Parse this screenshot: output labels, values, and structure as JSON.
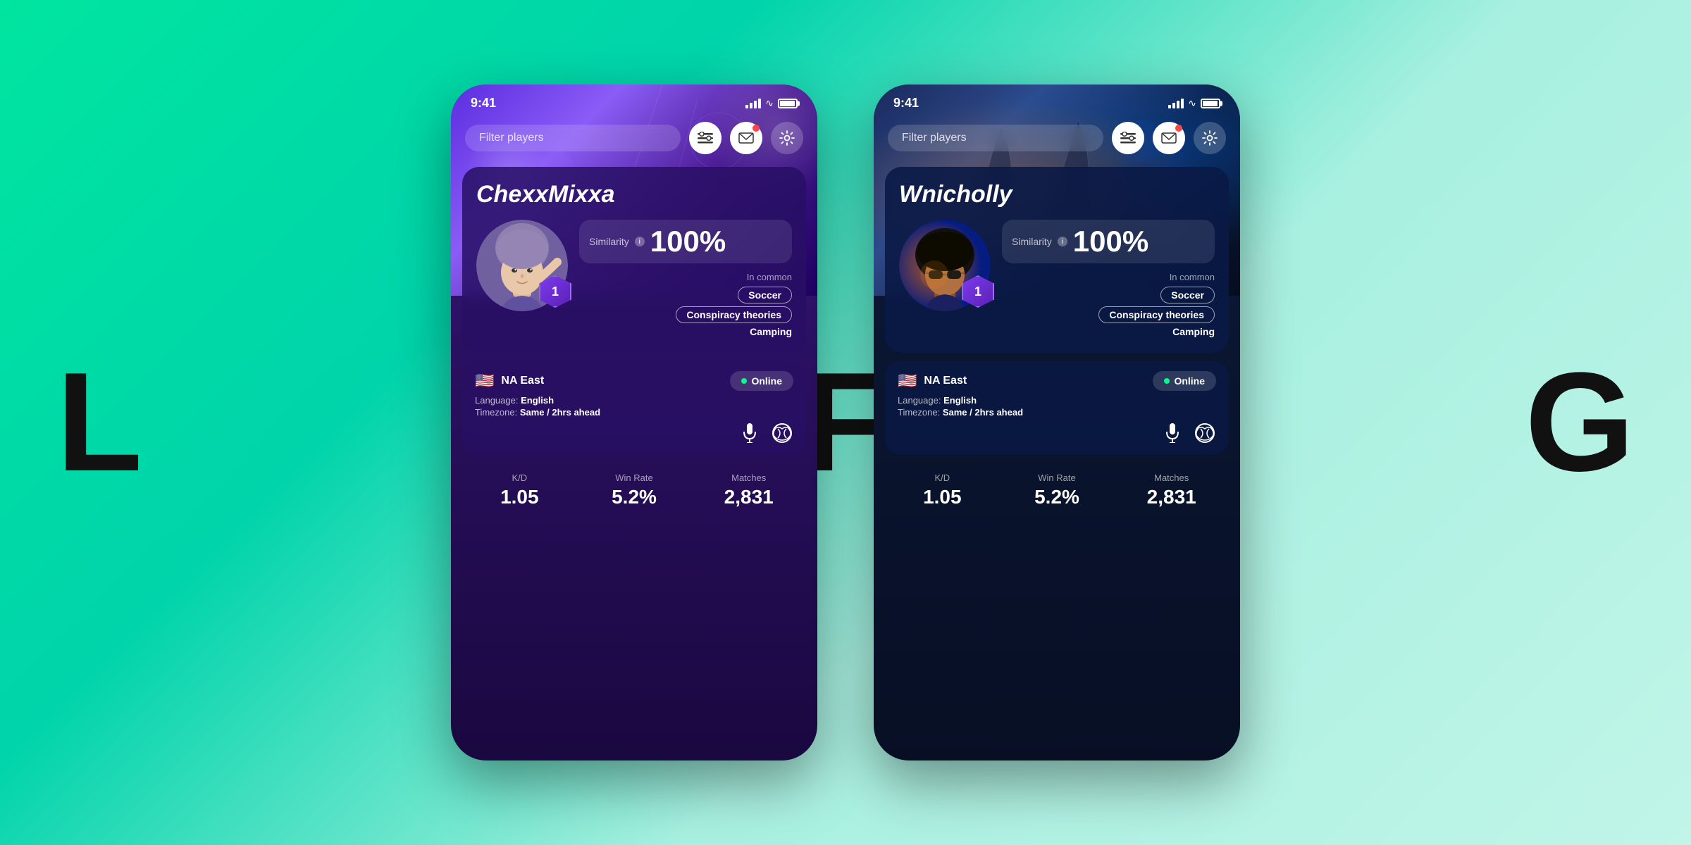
{
  "background": {
    "color_start": "#00e5a0",
    "color_end": "#c0f5e8"
  },
  "letters": {
    "left": "L",
    "middle": "F",
    "right": "G"
  },
  "phone1": {
    "theme": "purple",
    "status_bar": {
      "time": "9:41"
    },
    "search": {
      "placeholder": "Filter players"
    },
    "player_name": "ChexxMixxa",
    "similarity_label": "Similarity",
    "similarity_value": "100%",
    "in_common_label": "In common",
    "tags": [
      "Soccer",
      "Conspiracy theories",
      "Camping"
    ],
    "region": "NA East",
    "language_label": "Language:",
    "language_value": "English",
    "timezone_label": "Timezone:",
    "timezone_value": "Same / 2hrs ahead",
    "online_status": "Online",
    "rank": "1",
    "stats": [
      {
        "label": "K/D",
        "value": "1.05"
      },
      {
        "label": "Win Rate",
        "value": "5.2%"
      },
      {
        "label": "Matches",
        "value": "2,831"
      }
    ]
  },
  "phone2": {
    "theme": "dark",
    "status_bar": {
      "time": "9:41"
    },
    "search": {
      "placeholder": "Filter players"
    },
    "player_name": "Wnicholly",
    "similarity_label": "Similarity",
    "similarity_value": "100%",
    "in_common_label": "In common",
    "tags": [
      "Soccer",
      "Conspiracy theories",
      "Camping"
    ],
    "region": "NA East",
    "language_label": "Language:",
    "language_value": "English",
    "timezone_label": "Timezone:",
    "timezone_value": "Same / 2hrs ahead",
    "online_status": "Online",
    "rank": "1",
    "stats": [
      {
        "label": "K/D",
        "value": "1.05"
      },
      {
        "label": "Win Rate",
        "value": "5.2%"
      },
      {
        "label": "Matches",
        "value": "2,831"
      }
    ]
  },
  "icons": {
    "filter": "⊟",
    "mail": "✉",
    "gear": "⚙",
    "mic": "🎤",
    "xbox": "⊗",
    "info": "i"
  }
}
